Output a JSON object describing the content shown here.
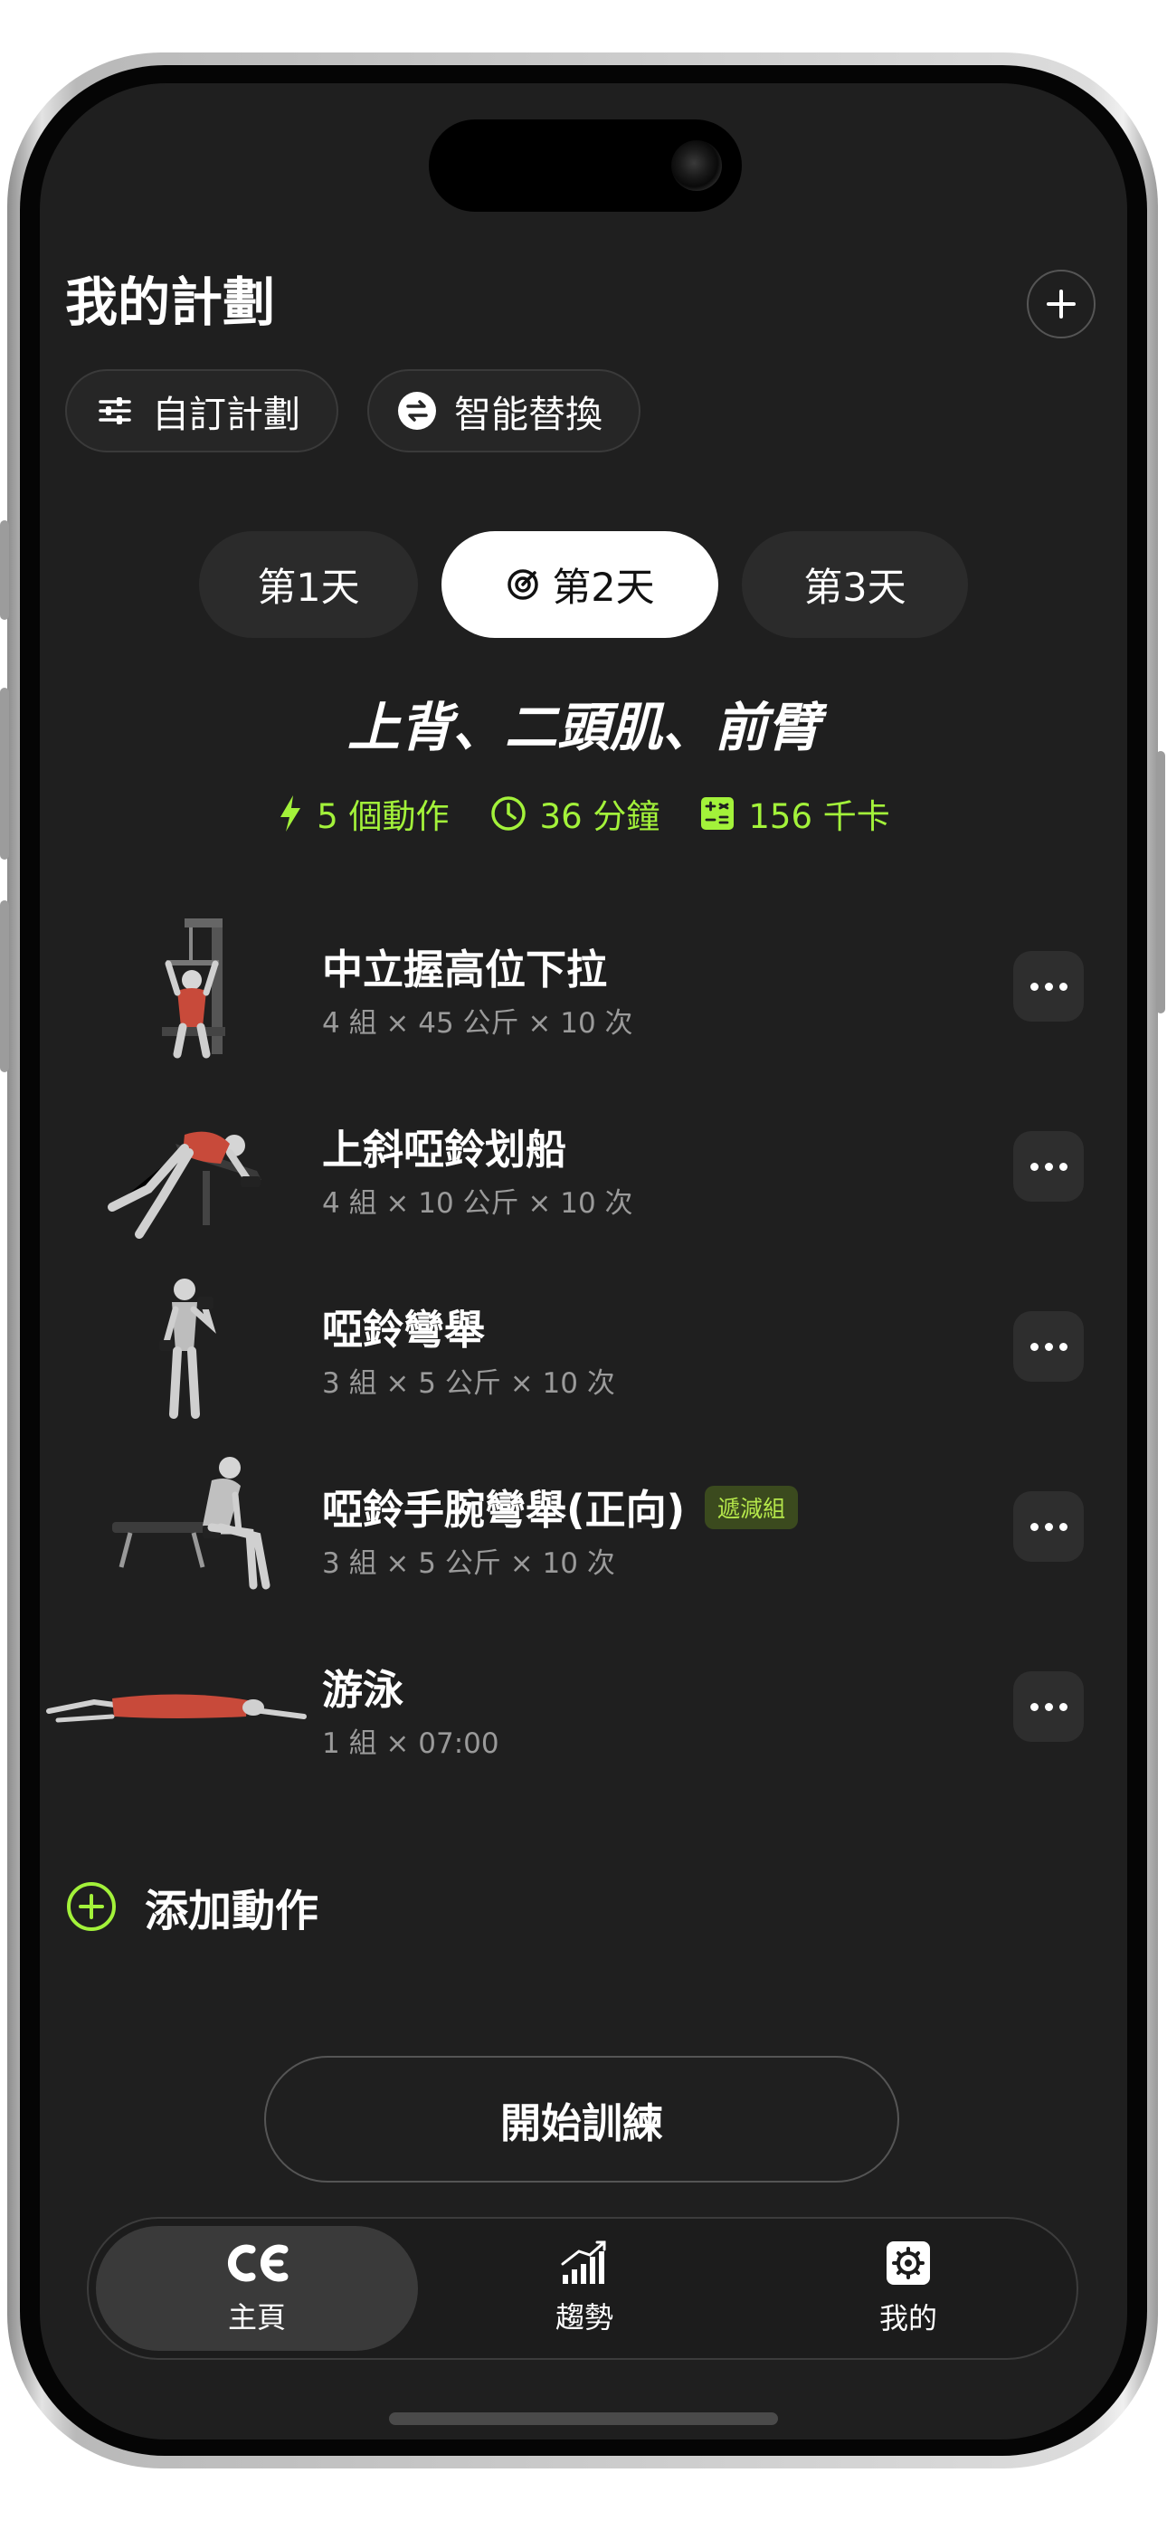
{
  "header": {
    "title": "我的計劃"
  },
  "actions": {
    "custom_plan": "自訂計劃",
    "smart_swap": "智能替換"
  },
  "day_tabs": [
    {
      "label": "第1天",
      "active": false
    },
    {
      "label": "第2天",
      "active": true
    },
    {
      "label": "第3天",
      "active": false
    }
  ],
  "workout": {
    "title": "上背、二頭肌、前臂",
    "stats": {
      "exercises": "5 個動作",
      "duration": "36 分鐘",
      "calories": "156 千卡"
    }
  },
  "exercises": [
    {
      "name": "中立握高位下拉",
      "detail": "4 組 × 45 公斤 × 10 次"
    },
    {
      "name": "上斜啞鈴划船",
      "detail": "4 組 × 10 公斤 × 10 次"
    },
    {
      "name": "啞鈴彎舉",
      "detail": "3 組 × 5 公斤 × 10 次"
    },
    {
      "name": "啞鈴手腕彎舉(正向)",
      "detail": "3 組 × 5 公斤 × 10 次",
      "badge": "遞減組"
    },
    {
      "name": "游泳",
      "detail": "1 組 × 07:00"
    }
  ],
  "add_exercise": "添加動作",
  "start_button": "開始訓練",
  "tabbar": {
    "home": "主頁",
    "trends": "趨勢",
    "mine": "我的"
  },
  "colors": {
    "accent": "#a3f23a",
    "background": "#1f1f1f",
    "muscle_highlight": "#c84a3a"
  }
}
